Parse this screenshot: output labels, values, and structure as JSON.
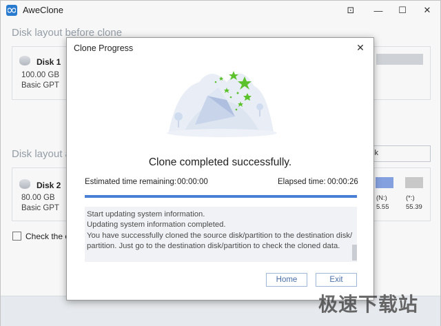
{
  "app": {
    "title": "AweClone",
    "icons": {
      "logo": "aweclone-logo-icon",
      "pin": "pin-icon",
      "minimize": "minimize-icon",
      "maximize": "maximize-icon",
      "close": "close-icon"
    },
    "window_controls": {
      "pin": "⊡",
      "minimize": "—",
      "maximize": "☐",
      "close": "✕"
    }
  },
  "background": {
    "section_before": "Disk layout before clone",
    "section_after": "Disk layout a",
    "disk1": {
      "name": "Disk 1",
      "size": "100.00 GB",
      "type": "Basic GPT"
    },
    "disk2": {
      "name": "Disk 2",
      "size": "80.00 GB",
      "type": "Basic GPT"
    },
    "search_fragment": "sk",
    "partitions": [
      {
        "label": "(N:)",
        "size": "5.55",
        "color": "#8aa6e6"
      },
      {
        "label": "(*:)",
        "size": "55.39",
        "color": "#cfcfcf"
      }
    ],
    "check_label": "Check the op"
  },
  "dialog": {
    "title": "Clone Progress",
    "close_glyph": "✕",
    "status": "Clone completed successfully.",
    "estimated_label": "Estimated time remaining:",
    "estimated_value": "00:00:00",
    "elapsed_label": "Elapsed time:",
    "elapsed_value": "00:00:26",
    "progress_percent": 100,
    "log": [
      "Start updating system information.",
      "Updating system information completed.",
      "You have successfully cloned the source disk/partition to the destination disk/",
      "partition. Just go to the destination disk/partition to check the cloned data."
    ],
    "home_button": "Home",
    "exit_button": "Exit"
  },
  "watermark": "极速下载站",
  "colors": {
    "accent": "#4a7fd6",
    "button_text": "#4a6fa8",
    "star_green": "#5cc22b"
  }
}
